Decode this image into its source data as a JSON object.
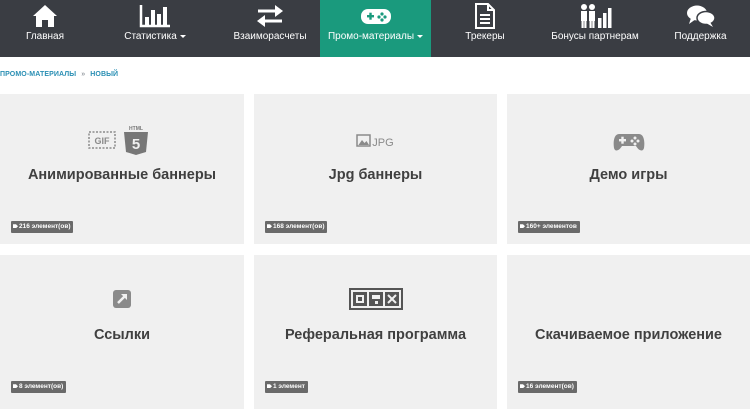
{
  "nav": {
    "items": [
      {
        "label": "Главная",
        "icon": "home-icon"
      },
      {
        "label": "Статистика",
        "icon": "bar-chart-icon"
      },
      {
        "label": "Взаиморасчеты",
        "icon": "exchange-arrows-icon"
      },
      {
        "label": "Промо-материалы",
        "icon": "gamepad-icon"
      },
      {
        "label": "Трекеры",
        "icon": "document-icon"
      },
      {
        "label": "Бонусы партнерам",
        "icon": "partners-icon"
      },
      {
        "label": "Поддержка",
        "icon": "chat-bubbles-icon"
      }
    ],
    "active_index": 3,
    "bg_color": "#3a3d43",
    "active_color": "#1a9a7d"
  },
  "breadcrumb": {
    "items": [
      "ПРОМО-МАТЕРИАЛЫ",
      "НОВЫЙ"
    ],
    "separator": "»",
    "color": "#2a8fb4"
  },
  "cards": [
    {
      "title": "Анимированные баннеры",
      "badge": "216 элемент(ов)",
      "icon": "gif-html5-icon",
      "icon_text": {
        "gif": "GIF",
        "html": "HTML",
        "five": "5"
      }
    },
    {
      "title": "Jpg баннеры",
      "badge": "168 элемент(ов)",
      "icon": "jpg-image-icon",
      "icon_text": {
        "jpg": "JPG"
      }
    },
    {
      "title": "Демо игры",
      "badge": "160+ элементов",
      "icon": "gamepad-icon"
    },
    {
      "title": "Ссылки",
      "badge": "8 элемент(ов)",
      "icon": "external-link-icon"
    },
    {
      "title": "Реферальная программа",
      "badge": "1 элемент",
      "icon": "referral-qr-icon"
    },
    {
      "title": "Скачиваемое приложение",
      "badge": "16 элемент(ов)",
      "icon": "download-app-icon"
    }
  ]
}
